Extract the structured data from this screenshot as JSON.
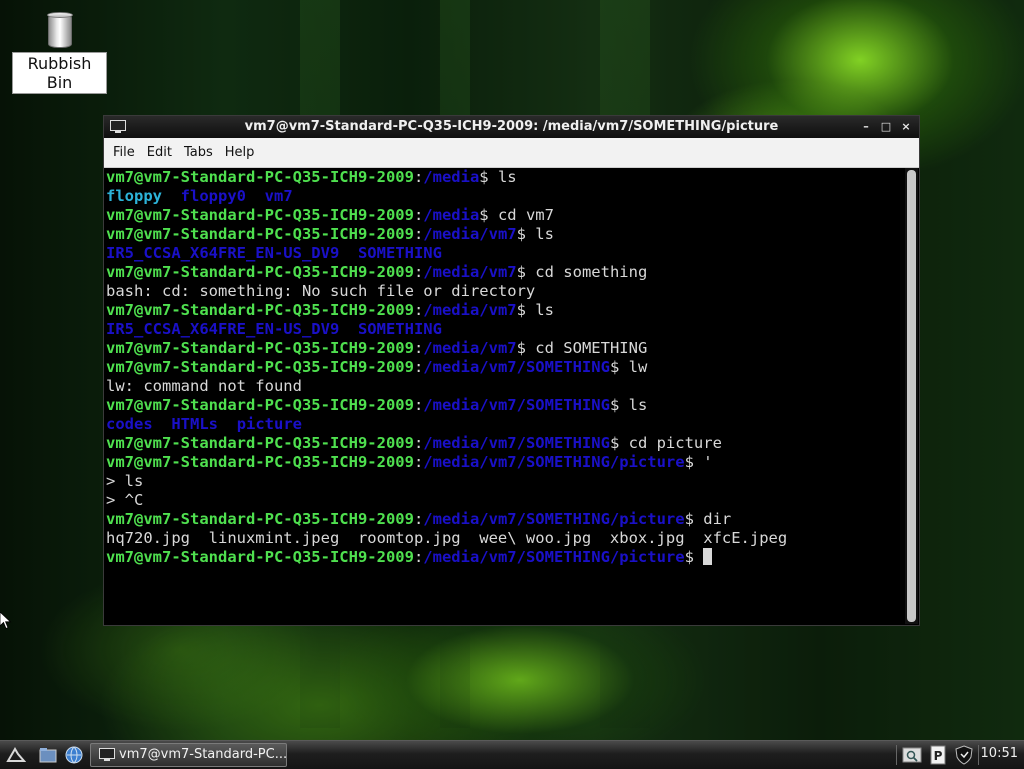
{
  "desktop": {
    "icons": [
      {
        "label": "Rubbish Bin",
        "icon": "trash-icon"
      }
    ]
  },
  "window": {
    "title": "vm7@vm7-Standard-PC-Q35-ICH9-2009: /media/vm7/SOMETHING/picture",
    "icon": "terminal-icon",
    "controls": {
      "minimize": "–",
      "maximize": "□",
      "close": "×"
    },
    "menu": [
      "File",
      "Edit",
      "Tabs",
      "Help"
    ]
  },
  "terminal": {
    "user": "vm7@vm7-Standard-PC-Q35-ICH9-2009",
    "colors": {
      "user": "#4fe04f",
      "path": "#1a10c8",
      "dir_cyan": "#2cb3d9",
      "text": "#d8d8d8",
      "background": "#000000"
    },
    "lines": [
      {
        "type": "prompt",
        "path": "/media",
        "cmd": "ls"
      },
      {
        "type": "dirs",
        "items": [
          {
            "name": "floppy",
            "color": "cyan"
          },
          {
            "name": "floppy0",
            "color": "blue"
          },
          {
            "name": "vm7",
            "color": "blue"
          }
        ]
      },
      {
        "type": "prompt",
        "path": "/media",
        "cmd": "cd vm7"
      },
      {
        "type": "prompt",
        "path": "/media/vm7",
        "cmd": "ls"
      },
      {
        "type": "dirs",
        "items": [
          {
            "name": "IR5_CCSA_X64FRE_EN-US_DV9",
            "color": "blue"
          },
          {
            "name": "SOMETHING",
            "color": "blue"
          }
        ]
      },
      {
        "type": "prompt",
        "path": "/media/vm7",
        "cmd": "cd something"
      },
      {
        "type": "text",
        "text": "bash: cd: something: No such file or directory"
      },
      {
        "type": "prompt",
        "path": "/media/vm7",
        "cmd": "ls"
      },
      {
        "type": "dirs",
        "items": [
          {
            "name": "IR5_CCSA_X64FRE_EN-US_DV9",
            "color": "blue"
          },
          {
            "name": "SOMETHING",
            "color": "blue"
          }
        ]
      },
      {
        "type": "prompt",
        "path": "/media/vm7",
        "cmd": "cd SOMETHING"
      },
      {
        "type": "prompt",
        "path": "/media/vm7/SOMETHING",
        "cmd": "lw"
      },
      {
        "type": "text",
        "text": "lw: command not found"
      },
      {
        "type": "prompt",
        "path": "/media/vm7/SOMETHING",
        "cmd": "ls"
      },
      {
        "type": "dirs",
        "items": [
          {
            "name": "codes",
            "color": "blue"
          },
          {
            "name": "HTMLs",
            "color": "blue"
          },
          {
            "name": "picture",
            "color": "blue"
          }
        ]
      },
      {
        "type": "prompt",
        "path": "/media/vm7/SOMETHING",
        "cmd": "cd picture"
      },
      {
        "type": "prompt",
        "path": "/media/vm7/SOMETHING/picture",
        "cmd": "'"
      },
      {
        "type": "text",
        "text": "> ls"
      },
      {
        "type": "text",
        "text": "> ^C"
      },
      {
        "type": "prompt",
        "path": "/media/vm7/SOMETHING/picture",
        "cmd": "dir"
      },
      {
        "type": "text",
        "text": "hq720.jpg  linuxmint.jpeg  roomtop.jpg  wee\\ woo.jpg  xbox.jpg  xfcE.jpeg"
      },
      {
        "type": "prompt",
        "path": "/media/vm7/SOMETHING/picture",
        "cmd": "",
        "cursor": true
      }
    ]
  },
  "taskbar": {
    "launchers": [
      "menu-icon",
      "file-manager-icon",
      "web-browser-icon"
    ],
    "task_label": "vm7@vm7-Standard-PC...",
    "tray": [
      "search-icon",
      "clipboard-icon",
      "shield-icon"
    ],
    "clock": "10:51"
  }
}
